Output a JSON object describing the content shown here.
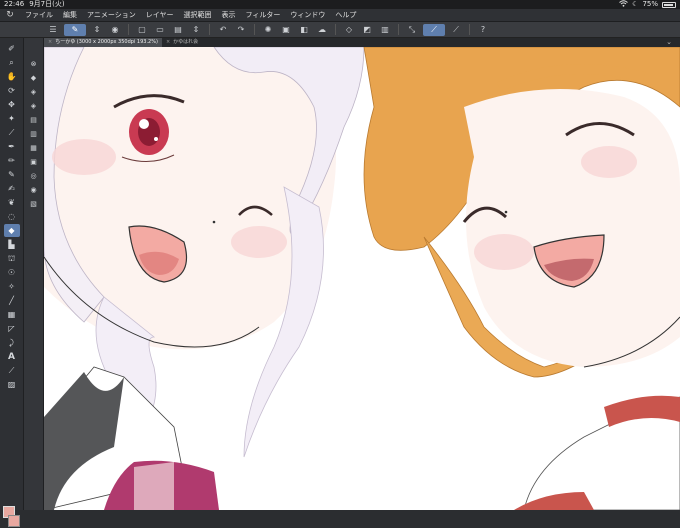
{
  "status": {
    "time": "22:46",
    "date": "9月7日(火)",
    "battery": "75%"
  },
  "menu": {
    "items": [
      "ファイル",
      "編集",
      "アニメーション",
      "レイヤー",
      "選択範囲",
      "表示",
      "フィルター",
      "ウィンドウ",
      "ヘルプ"
    ]
  },
  "tabs": {
    "active": "ちーかゆ (3000 x 2000px 350dpi 193.2%)",
    "second": "かゆはれ会"
  },
  "colors": {
    "accent": "#5f7fae",
    "foreground": "#e8a8a0",
    "canvas": "#ffffff"
  },
  "icons": {
    "app": "csp-app-icon",
    "wifi": "wifi-icon",
    "battery": "battery-icon"
  }
}
